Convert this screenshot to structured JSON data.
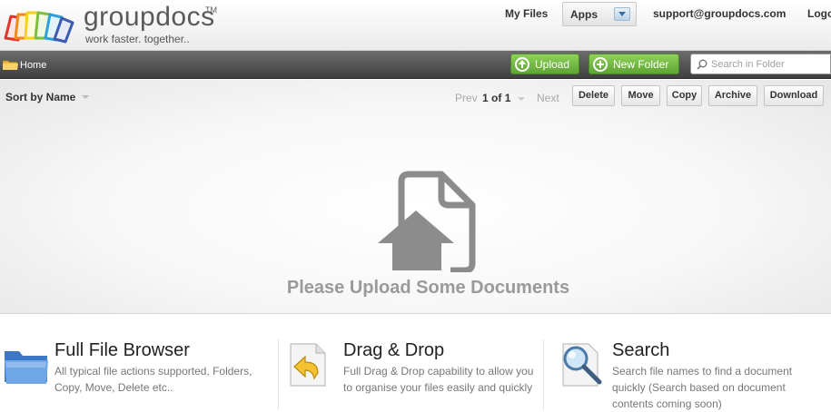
{
  "brand": {
    "name": "groupdocs",
    "tm": "TM",
    "tagline": "work faster. together..",
    "logo_colors": [
      "#e2362c",
      "#f08a1c",
      "#f5d21c",
      "#7bbf3c",
      "#2fa0d8",
      "#3a5bb0",
      "#8a4fa8"
    ]
  },
  "nav": {
    "my_files": "My Files",
    "apps": "Apps",
    "email": "support@groupdocs.com",
    "logout": "Logo"
  },
  "toolbar": {
    "breadcrumb": "Home",
    "upload": "Upload",
    "new_folder": "New Folder",
    "search_placeholder": "Search in Folder"
  },
  "files": {
    "sort_label": "Sort by Name",
    "prev": "Prev",
    "page_current": "1",
    "page_of": "of",
    "page_total": "1",
    "next": "Next",
    "actions": {
      "delete": "Delete",
      "move": "Move",
      "copy": "Copy",
      "archive": "Archive",
      "download": "Download"
    },
    "empty_message": "Please Upload Some Documents"
  },
  "features": [
    {
      "title": "Full File Browser",
      "description": "All typical file actions supported, Folders, Copy, Move, Delete etc..",
      "icon": "folder-icon"
    },
    {
      "title": "Drag & Drop",
      "description": "Full Drag & Drop capability to allow you to organise your files easily and quickly",
      "icon": "drag-drop-icon"
    },
    {
      "title": "Search",
      "description": "Search file names to find a document quickly (Search based on document contents coming soon)",
      "icon": "magnifier-icon"
    }
  ],
  "colors": {
    "toolbar_dark": "#4f4f4f",
    "green_button": "#6fb540",
    "empty_icon": "#8c8c8c"
  }
}
